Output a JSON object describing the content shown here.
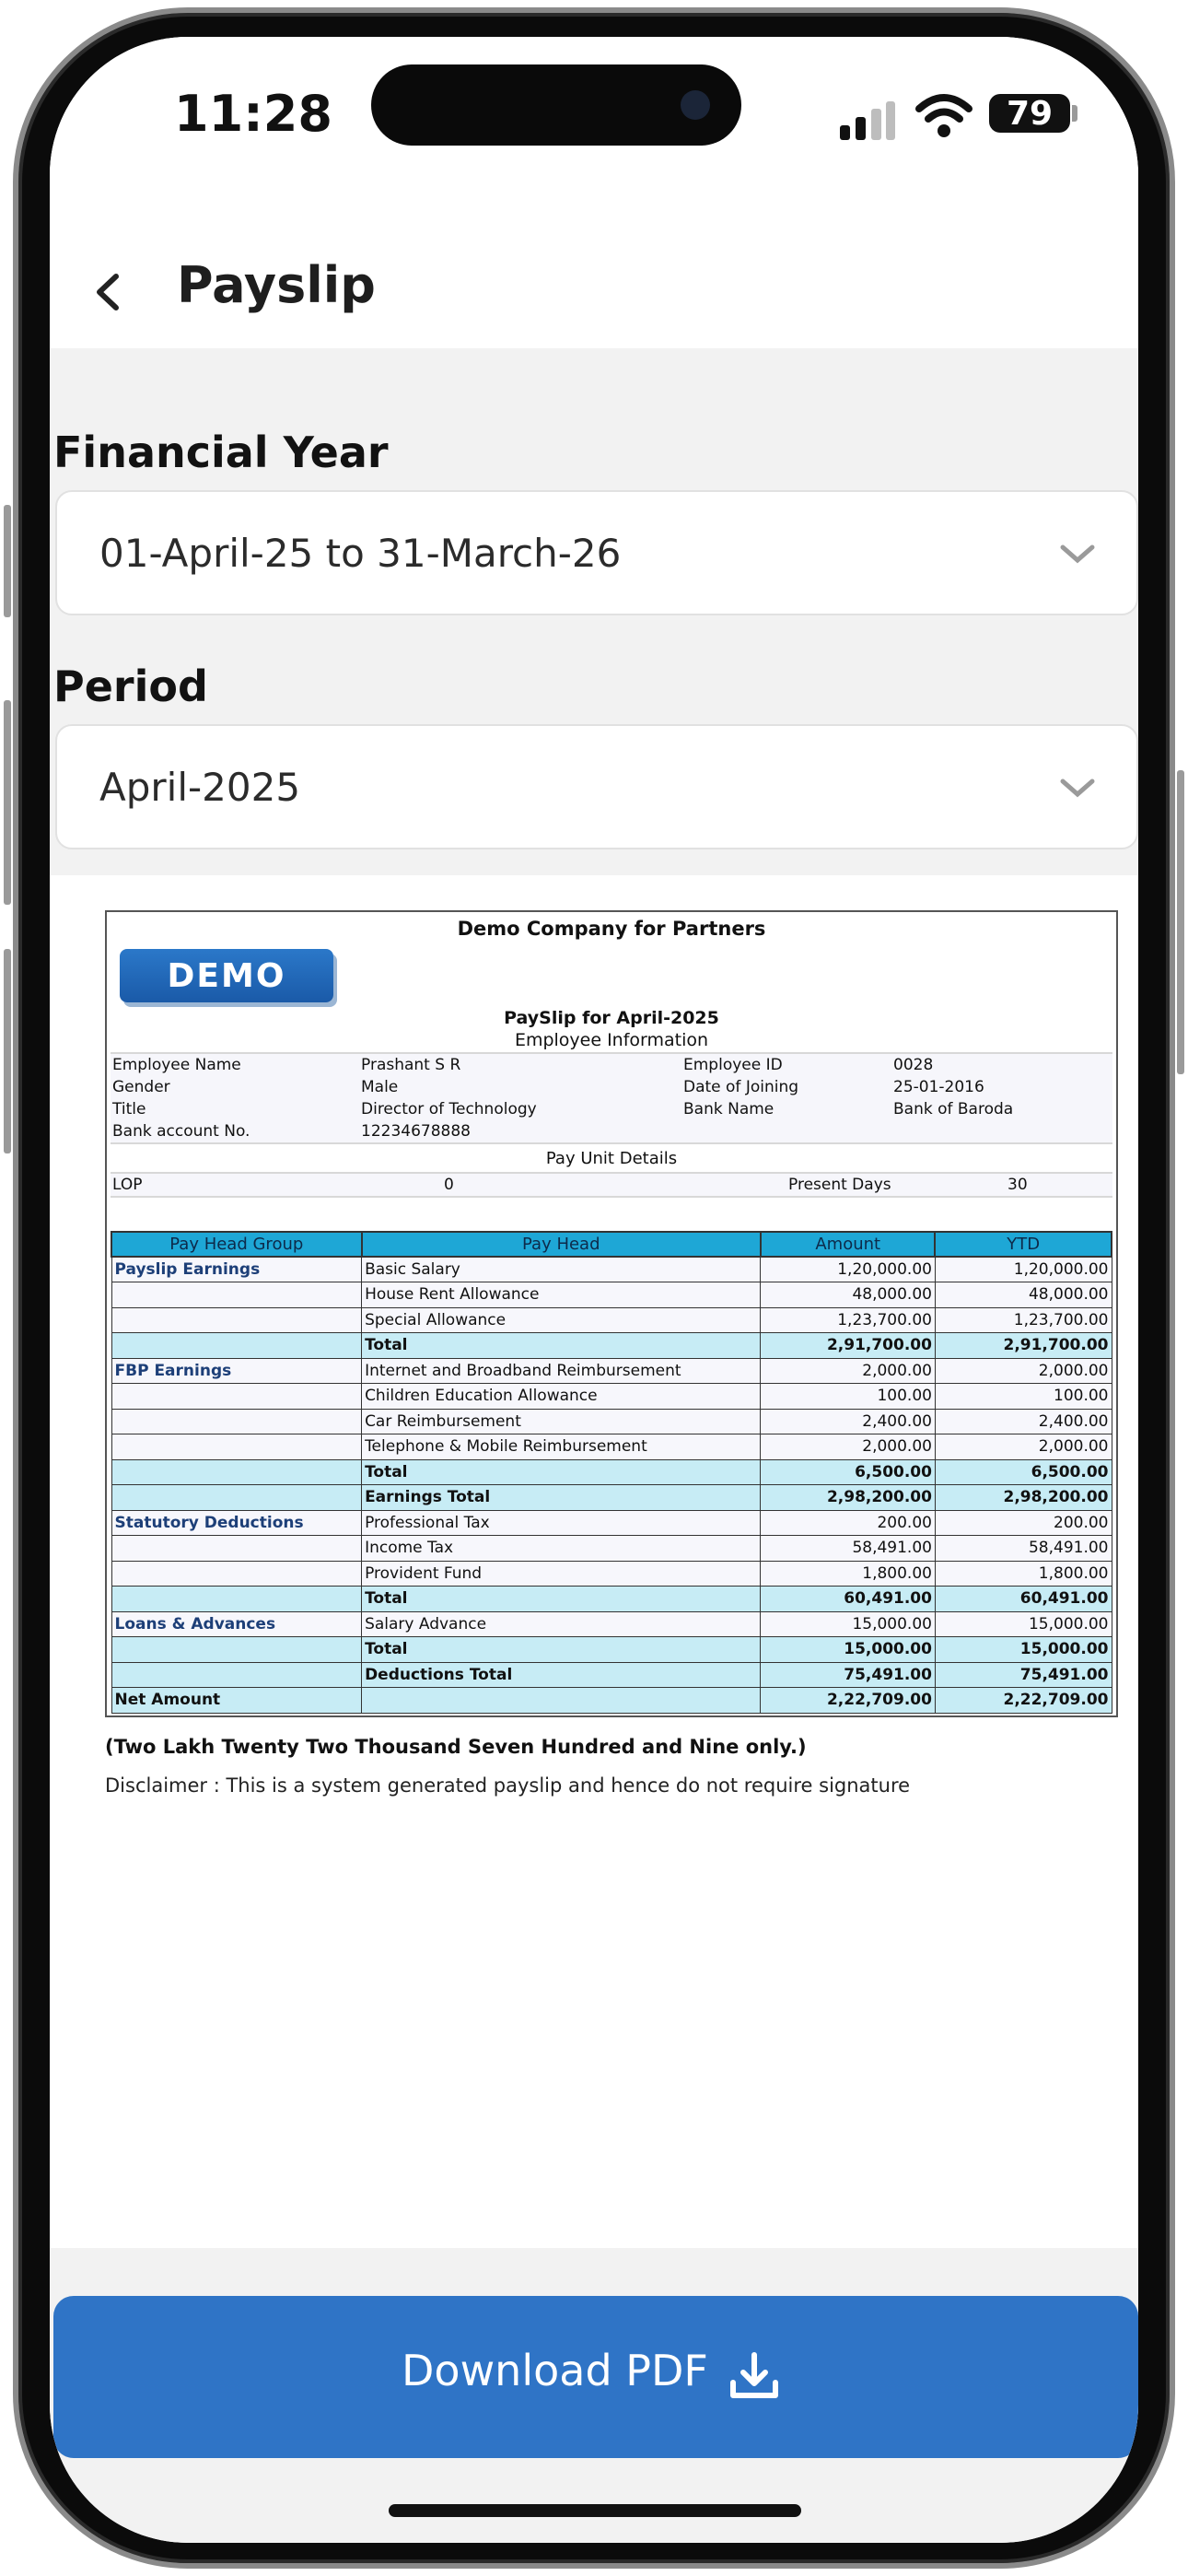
{
  "status_bar": {
    "time": "11:28",
    "battery": "79"
  },
  "header": {
    "title": "Payslip"
  },
  "form": {
    "financial_year_label": "Financial Year",
    "financial_year_value": "01-April-25 to 31-March-26",
    "period_label": "Period",
    "period_value": "April-2025"
  },
  "payslip": {
    "company": "Demo Company for Partners",
    "logo_text": "DEMO",
    "title": "PaySlip for April-2025",
    "employee_info_title": "Employee Information",
    "employee_info": [
      [
        "Employee Name",
        "Prashant S R",
        "Employee ID",
        "0028"
      ],
      [
        "Gender",
        "Male",
        "Date of Joining",
        "25-01-2016"
      ],
      [
        "Title",
        "Director of Technology",
        "Bank Name",
        "Bank of Baroda"
      ],
      [
        "Bank account No.",
        "12234678888",
        "",
        ""
      ]
    ],
    "pay_unit_title": "Pay Unit Details",
    "lop_label": "LOP",
    "lop_value": "0",
    "present_days_label": "Present Days",
    "present_days_value": "30",
    "columns": [
      "Pay Head Group",
      "Pay Head",
      "Amount",
      "YTD"
    ],
    "rows": [
      {
        "group": "Payslip Earnings",
        "head": "Basic Salary",
        "amount": "1,20,000.00",
        "ytd": "1,20,000.00",
        "total": false
      },
      {
        "group": "",
        "head": "House Rent Allowance",
        "amount": "48,000.00",
        "ytd": "48,000.00",
        "total": false
      },
      {
        "group": "",
        "head": "Special Allowance",
        "amount": "1,23,700.00",
        "ytd": "1,23,700.00",
        "total": false
      },
      {
        "group": "",
        "head": "Total",
        "amount": "2,91,700.00",
        "ytd": "2,91,700.00",
        "total": true
      },
      {
        "group": "FBP Earnings",
        "head": "Internet and Broadband Reimbursement",
        "amount": "2,000.00",
        "ytd": "2,000.00",
        "total": false
      },
      {
        "group": "",
        "head": "Children Education Allowance",
        "amount": "100.00",
        "ytd": "100.00",
        "total": false
      },
      {
        "group": "",
        "head": "Car Reimbursement",
        "amount": "2,400.00",
        "ytd": "2,400.00",
        "total": false
      },
      {
        "group": "",
        "head": "Telephone & Mobile Reimbursement",
        "amount": "2,000.00",
        "ytd": "2,000.00",
        "total": false
      },
      {
        "group": "",
        "head": "Total",
        "amount": "6,500.00",
        "ytd": "6,500.00",
        "total": true
      },
      {
        "group": "",
        "head": "Earnings Total",
        "amount": "2,98,200.00",
        "ytd": "2,98,200.00",
        "total": true
      },
      {
        "group": "Statutory Deductions",
        "head": "Professional Tax",
        "amount": "200.00",
        "ytd": "200.00",
        "total": false
      },
      {
        "group": "",
        "head": "Income Tax",
        "amount": "58,491.00",
        "ytd": "58,491.00",
        "total": false
      },
      {
        "group": "",
        "head": "Provident Fund",
        "amount": "1,800.00",
        "ytd": "1,800.00",
        "total": false
      },
      {
        "group": "",
        "head": "Total",
        "amount": "60,491.00",
        "ytd": "60,491.00",
        "total": true
      },
      {
        "group": "Loans & Advances",
        "head": "Salary Advance",
        "amount": "15,000.00",
        "ytd": "15,000.00",
        "total": false
      },
      {
        "group": "",
        "head": "Total",
        "amount": "15,000.00",
        "ytd": "15,000.00",
        "total": true
      },
      {
        "group": "",
        "head": "Deductions Total",
        "amount": "75,491.00",
        "ytd": "75,491.00",
        "total": true
      }
    ],
    "net_label": "Net Amount",
    "net_amount": "2,22,709.00",
    "net_ytd": "2,22,709.00",
    "amount_in_words": "(Two Lakh Twenty Two Thousand Seven Hundred and Nine only.)",
    "disclaimer": "Disclaimer : This is a system generated payslip and hence do not require signature"
  },
  "footer": {
    "download_label": "Download PDF",
    "download_icon": "download-icon"
  },
  "colors": {
    "accent": "#2f74c6",
    "table_header": "#1ea7d6",
    "total_row": "#c7ecf5"
  }
}
